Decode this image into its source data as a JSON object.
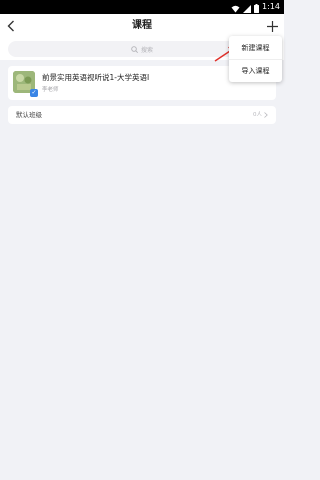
{
  "status_bar": {
    "time": "1:14"
  },
  "nav": {
    "title": "课程"
  },
  "search": {
    "placeholder": "搜索"
  },
  "course": {
    "name": "前景实用英语视听说1-大学英语I",
    "teacher": "李老师",
    "badge": "✓"
  },
  "class": {
    "name": "默认班级",
    "count": "0人"
  },
  "menu": {
    "new_course": "新建课程",
    "import_course": "导入课程"
  },
  "colors": {
    "accent": "#3a85e6",
    "annotation_arrow": "#e0312b",
    "background": "#f1f2f6"
  }
}
